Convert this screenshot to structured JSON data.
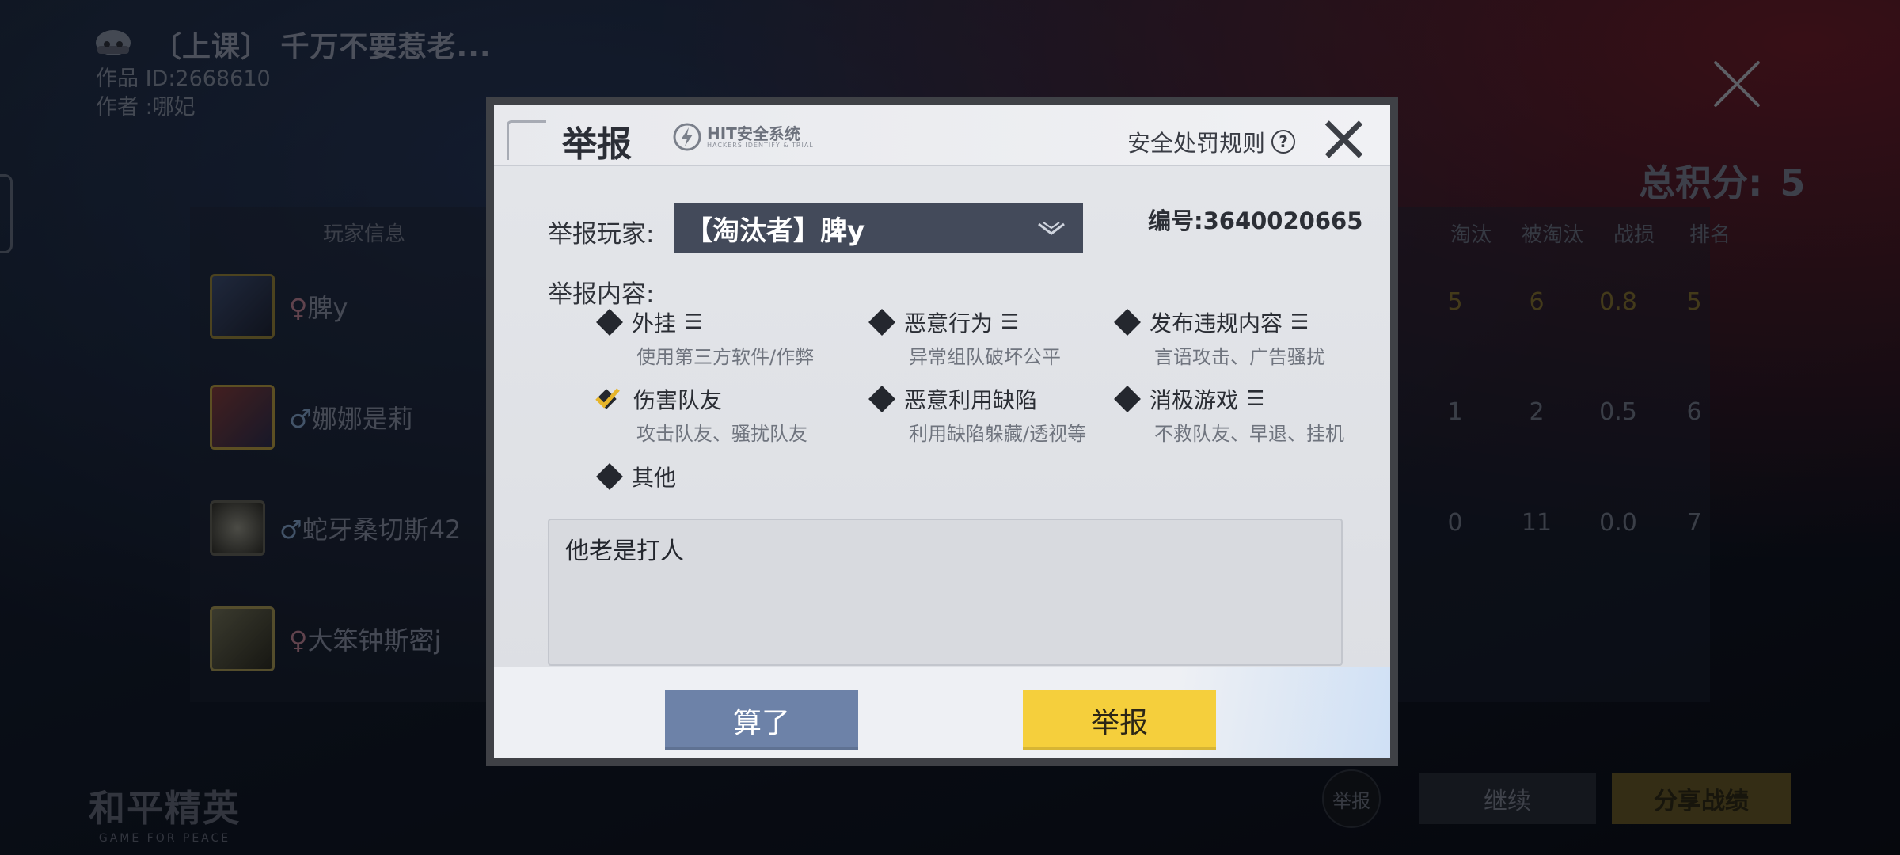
{
  "background": {
    "work_title": "〔上课〕 千万不要惹老...",
    "work_id": "作品 ID:2668610",
    "work_author": "作者 :哪妃",
    "total_score_label": "总积分:",
    "total_score_value": "5",
    "panel_header": "玩家信息",
    "stat_headers": [
      "淘汰",
      "被淘汰",
      "战损",
      "排名"
    ],
    "players": [
      {
        "gender": "♀",
        "name": "脾y",
        "stats": [
          "5",
          "6",
          "0.8",
          "5"
        ]
      },
      {
        "gender": "♂",
        "name": "娜娜是莉",
        "stats": [
          "1",
          "2",
          "0.5",
          "6"
        ]
      },
      {
        "gender": "♂",
        "name": "蛇牙桑切斯42",
        "stats": [
          "0",
          "11",
          "0.0",
          "7"
        ]
      },
      {
        "gender": "♀",
        "name": "大笨钟斯密j",
        "stats": []
      }
    ],
    "logo_main": "和平精英",
    "logo_sub": "GAME FOR PEACE",
    "report_button": "举报",
    "continue_button": "继续",
    "share_button": "分享战绩"
  },
  "dialog": {
    "title": "举报",
    "security_logo_text": "HIT安全系统",
    "security_logo_sub": "HACKERS IDENTIFY & TRIAL",
    "rules_link": "安全处罚规则",
    "report_player_label": "举报玩家:",
    "selected_player": "【淘汰者】脾y",
    "report_id": "编号:3640020665",
    "report_content_label": "举报内容:",
    "options": [
      {
        "label": "外挂",
        "more": "☰",
        "desc": "使用第三方软件/作弊",
        "checked": false
      },
      {
        "label": "恶意行为",
        "more": "☰",
        "desc": "异常组队破坏公平",
        "checked": false
      },
      {
        "label": "发布违规内容",
        "more": "☰",
        "desc": "言语攻击、广告骚扰",
        "checked": false
      },
      {
        "label": "伤害队友",
        "more": "",
        "desc": "攻击队友、骚扰队友",
        "checked": true
      },
      {
        "label": "恶意利用缺陷",
        "more": "",
        "desc": "利用缺陷躲藏/透视等",
        "checked": false
      },
      {
        "label": "消极游戏",
        "more": "☰",
        "desc": "不救队友、早退、挂机",
        "checked": false
      },
      {
        "label": "其他",
        "more": "",
        "desc": "",
        "checked": false
      }
    ],
    "description_text": "他老是打人",
    "cancel_button": "算了",
    "submit_button": "举报"
  },
  "colors": {
    "submit": "#f5cf3c",
    "cancel": "#6d82a8",
    "select_bg": "#434a5a",
    "check_accent": "#e7b52a"
  }
}
